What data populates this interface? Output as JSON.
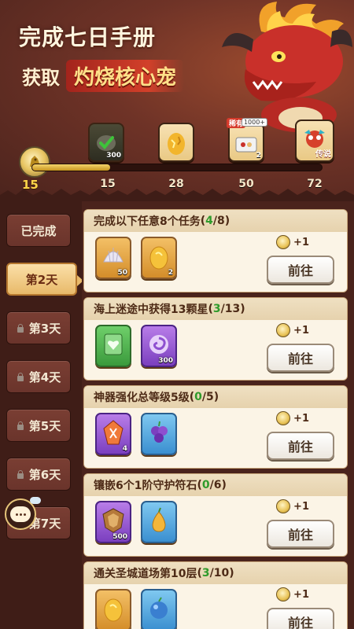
{
  "banner": {
    "title_line1": "完成七日手册",
    "title_line2a": "获取",
    "title_line2b": "灼烧核心宠"
  },
  "progress": {
    "current": "15",
    "fill_fraction": 0.27,
    "milestones": [
      {
        "value": "15",
        "count": "300",
        "state": "claimed"
      },
      {
        "value": "28",
        "state": "locked"
      },
      {
        "value": "50",
        "count": "2",
        "tag": "稀有",
        "tag2": "1000+",
        "state": "locked"
      },
      {
        "value": "72",
        "tag": "传说",
        "state": "locked"
      }
    ]
  },
  "tabs": [
    {
      "label": "已完成",
      "locked": false,
      "active": false
    },
    {
      "label": "第2天",
      "locked": false,
      "active": true
    },
    {
      "label": "第3天",
      "locked": true,
      "active": false
    },
    {
      "label": "第4天",
      "locked": true,
      "active": false
    },
    {
      "label": "第5天",
      "locked": true,
      "active": false
    },
    {
      "label": "第6天",
      "locked": true,
      "active": false
    },
    {
      "label": "第7天",
      "locked": true,
      "active": false
    }
  ],
  "tasks": [
    {
      "title": "完成以下任意8个任务",
      "progress_done": "4",
      "progress_total": "/8",
      "reward": "+1",
      "button": "前往",
      "items": [
        {
          "icon": "shell-icon",
          "color": "gold",
          "count": "50"
        },
        {
          "icon": "golden-egg-icon",
          "color": "gold",
          "count": "2"
        }
      ]
    },
    {
      "title": "海上迷途中获得13颗星",
      "progress_done": "3",
      "progress_total": "/13",
      "reward": "+1",
      "button": "前往",
      "items": [
        {
          "icon": "heart-scroll-icon",
          "color": "green",
          "count": ""
        },
        {
          "icon": "swirl-orb-icon",
          "color": "purple",
          "count": "300"
        }
      ]
    },
    {
      "title": "神器强化总等级5级",
      "progress_done": "0",
      "progress_total": "/5",
      "reward": "+1",
      "button": "前往",
      "items": [
        {
          "icon": "rune-crystal-icon",
          "color": "purple",
          "count": "4"
        },
        {
          "icon": "grape-icon",
          "color": "blue",
          "count": ""
        }
      ]
    },
    {
      "title": "镶嵌6个1阶守护符石",
      "progress_done": "0",
      "progress_total": "/6",
      "reward": "+1",
      "button": "前往",
      "items": [
        {
          "icon": "shield-stone-icon",
          "color": "purple",
          "count": "500"
        },
        {
          "icon": "pear-icon",
          "color": "blue",
          "count": ""
        }
      ]
    },
    {
      "title": "通关圣城道场第10层",
      "progress_done": "3",
      "progress_total": "/10",
      "reward": "+1",
      "button": "前往",
      "items": [
        {
          "icon": "golden-egg-icon",
          "color": "gold",
          "count": ""
        },
        {
          "icon": "berry-icon",
          "color": "blue",
          "count": ""
        }
      ]
    }
  ],
  "colors": {
    "accent_gold": "#e8b96a",
    "progress_green": "#2f9b2b",
    "banner_red": "#d2402a"
  }
}
